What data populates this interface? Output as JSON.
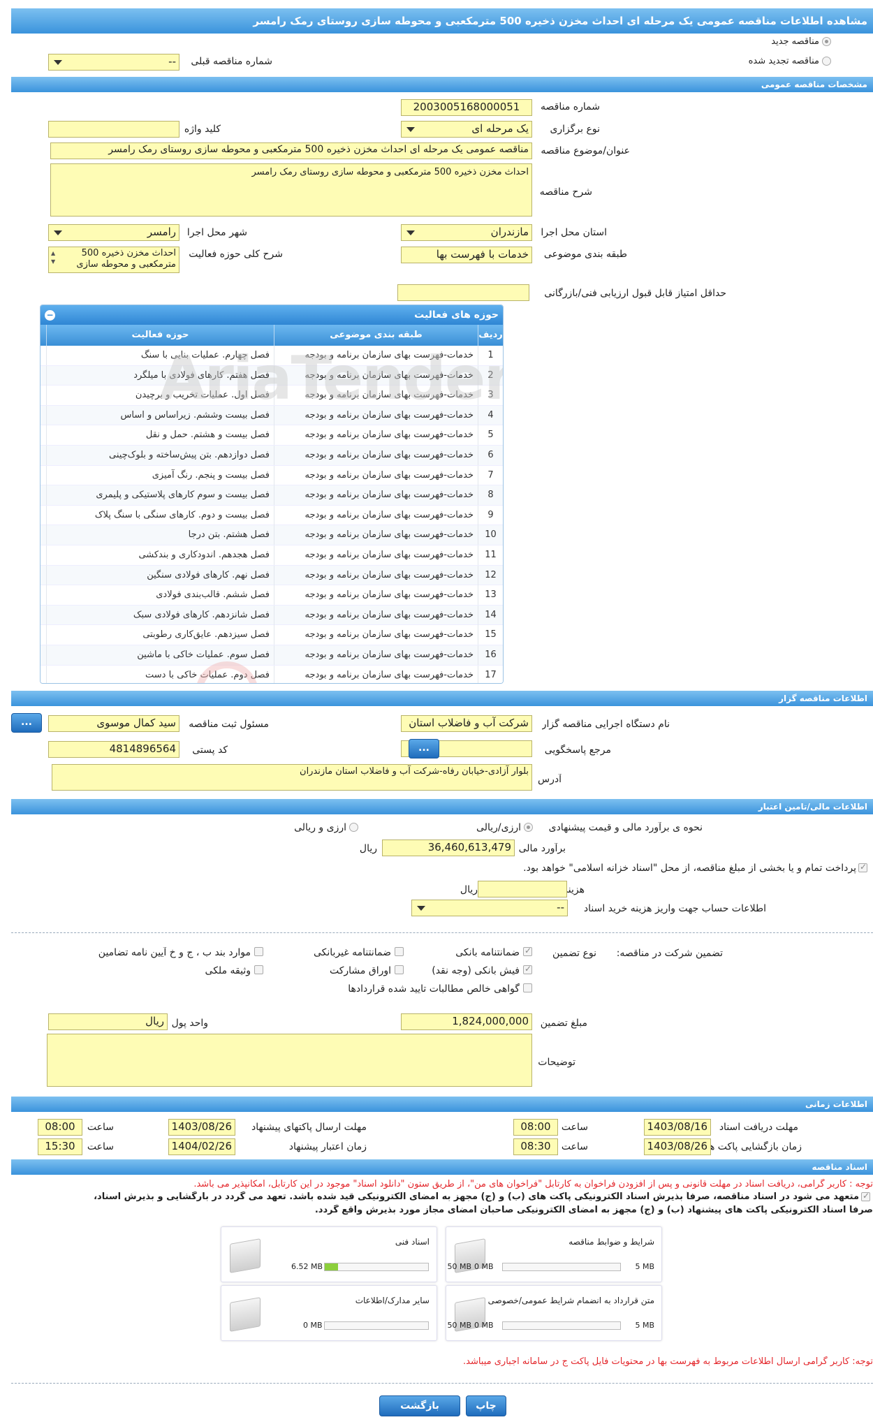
{
  "title": "مشاهده اطلاعات مناقصه عمومی یک مرحله ای احداث مخزن ذخیره 500 مترمکعبی و محوطه سازی روستای رمک رامسر",
  "top": {
    "new_label": "مناقصه جدید",
    "renewed_label": "مناقصه تجدید شده",
    "prev_number_label": "شماره مناقصه قبلی",
    "prev_number_value": "--"
  },
  "general": {
    "section": "مشخصات مناقصه عمومی",
    "number_label": "شماره مناقصه",
    "number": "2003005168000051",
    "type_label": "نوع برگزاری",
    "type": "یک مرحله ای",
    "keyword_label": "کلید واژه",
    "keyword": "",
    "subject_label": "عنوان/موضوع مناقصه",
    "subject": "مناقصه عمومی یک مرحله ای احداث مخزن ذخیره  500 مترمکعبی و محوطه سازی روستای رمک رامسر",
    "desc_label": "شرح مناقصه",
    "desc": "احداث مخزن ذخیره  500 مترمکعبی و محوطه سازی روستای رمک رامسر",
    "province_label": "استان محل اجرا",
    "province": "مازندران",
    "city_label": "شهر محل اجرا",
    "city": "رامسر",
    "category_label": "طبقه بندی موضوعی",
    "category": "خدمات با فهرست بها",
    "activity_label": "شرح کلی حوزه فعالیت",
    "activity": "احداث مخزن ذخیره  500 مترمکعبی و محوطه سازی",
    "min_score_label": "حداقل امتیاز قابل قبول ارزیابی فنی/بازرگانی",
    "min_score": ""
  },
  "grid": {
    "title": "حوزه های فعالیت",
    "col_row": "ردیف",
    "col_cat": "طبقه بندی موضوعی",
    "col_field": "حوزه فعالیت",
    "rows": [
      [
        "1",
        "خدمات-فهرست بهای سازمان برنامه و بودجه",
        "فصل چهارم. عملیات بنایی با سنگ"
      ],
      [
        "2",
        "خدمات-فهرست بهای سازمان برنامه و بودجه",
        "فصل هفتم. کارهای فولادی با میلگرد"
      ],
      [
        "3",
        "خدمات-فهرست بهای سازمان برنامه و بودجه",
        "فصل اول. عملیات تخریب و برچیدن"
      ],
      [
        "4",
        "خدمات-فهرست بهای سازمان برنامه و بودجه",
        "فصل بیست وششم. زیراساس و اساس"
      ],
      [
        "5",
        "خدمات-فهرست بهای سازمان برنامه و بودجه",
        "فصل بیست و هشتم. حمل و نقل"
      ],
      [
        "6",
        "خدمات-فهرست بهای سازمان برنامه و بودجه",
        "فصل دوازدهم. بتن پیش‌ساخته و بلوک‌چینی"
      ],
      [
        "7",
        "خدمات-فهرست بهای سازمان برنامه و بودجه",
        "فصل بیست و پنجم. رنگ آمیزی"
      ],
      [
        "8",
        "خدمات-فهرست بهای سازمان برنامه و بودجه",
        "فصل بیست و سوم کارهای پلاستیکی و پلیمری"
      ],
      [
        "9",
        "خدمات-فهرست بهای سازمان برنامه و بودجه",
        "فصل بیست و دوم. کارهای سنگی با سنگ پلاک"
      ],
      [
        "10",
        "خدمات-فهرست بهای سازمان برنامه و بودجه",
        "فصل هشتم. بتن درجا"
      ],
      [
        "11",
        "خدمات-فهرست بهای سازمان برنامه و بودجه",
        "فصل هجدهم. اندودکاری و بندکشی"
      ],
      [
        "12",
        "خدمات-فهرست بهای سازمان برنامه و بودجه",
        "فصل نهم. کارهای فولادی سنگین"
      ],
      [
        "13",
        "خدمات-فهرست بهای سازمان برنامه و بودجه",
        "فصل ششم. قالب‌بندی فولادی"
      ],
      [
        "14",
        "خدمات-فهرست بهای سازمان برنامه و بودجه",
        "فصل شانزدهم. کارهای فولادی سبک"
      ],
      [
        "15",
        "خدمات-فهرست بهای سازمان برنامه و بودجه",
        "فصل سیزدهم. عایق‌کاری رطوبتی"
      ],
      [
        "16",
        "خدمات-فهرست بهای سازمان برنامه و بودجه",
        "فصل سوم. عملیات خاکی با ماشین"
      ],
      [
        "17",
        "خدمات-فهرست بهای سازمان برنامه و بودجه",
        "فصل دوم. عملیات خاکی با دست"
      ]
    ]
  },
  "org": {
    "section": "اطلاعات مناقصه گزار",
    "name_label": "نام دستگاه اجرایی مناقصه گزار",
    "name": "شرکت آب و فاضلاب استان",
    "resp_label": "مسئول ثبت مناقصه",
    "resp": "سید کمال موسوی",
    "ref_label": "مرجع پاسخگویی",
    "ref": "",
    "postal_label": "کد پستی",
    "postal": "4814896564",
    "address_label": "آدرس",
    "address": "بلوار آزادی-خیابان رفاه-شرکت آب و فاضلاب استان مازندران",
    "more": "..."
  },
  "finance": {
    "section": "اطلاعات مالی/تامین اعتبار",
    "est_type_label": "نحوه ی برآورد مالی و قیمت پیشنهادی",
    "opt1": "ارزی/ریالی",
    "opt2": "ارزی و ریالی",
    "estimate_label": "برآورد مالی",
    "estimate": "36,460,613,479",
    "rial": "ریال",
    "treasury": "پرداخت تمام و یا بخشی از مبلغ مناقصه، از محل \"اسناد خزانه اسلامی\" خواهد بود.",
    "doc_fee_label": "هزینه خرید اسناد",
    "doc_fee": "",
    "account_label": "اطلاعات حساب جهت واریز هزینه خرید اسناد",
    "account": "--"
  },
  "guarantee": {
    "label": "تضمین شرکت در مناقصه:",
    "type_label": "نوع تضمین",
    "bank": "ضمانتنامه بانکی",
    "nonbank": "ضمانتنامه غیربانکی",
    "items_bcd": "موارد بند ب ، ج و خ آیین نامه تضامین",
    "cash": "فیش بانکی (وجه نقد)",
    "bonds": "اوراق مشارکت",
    "property": "وثیقه ملکی",
    "claims": "گواهی خالص مطالبات تایید شده قراردادها",
    "amount_label": "مبلغ تضمین",
    "amount": "1,824,000,000",
    "currency_label": "واحد پول",
    "currency": "ریال",
    "notes_label": "توضیحات",
    "notes": ""
  },
  "timing": {
    "section": "اطلاعات زمانی",
    "recv_label": "مهلت دریافت اسناد",
    "recv_date": "1403/08/16",
    "recv_time": "08:00",
    "send_label": "مهلت ارسال پاکتهای پیشنهاد",
    "send_date": "1403/08/26",
    "send_time": "08:00",
    "open_label": "زمان بازگشایی پاکت ها",
    "open_date": "1403/08/26",
    "open_time": "08:30",
    "valid_label": "زمان اعتبار پیشنهاد",
    "valid_date": "1404/02/26",
    "valid_time": "15:30",
    "time_label": "ساعت"
  },
  "docs": {
    "section": "اسناد مناقصه",
    "note1": "توجه : کاربر گرامی، دریافت اسناد در مهلت قانونی و پس از افزودن فراخوان به کارتابل \"فراخوان های من\"، از طریق ستون \"دانلود اسناد\" موجود در این کارتابل، امکانپذیر می باشد.",
    "commit1": "متعهد می شود در اسناد مناقصه، صرفاً بذیرش اسناد الکترونیکی پاکت های (ب) و (ج) مجهز به امضای الکترونیکی قید شده باشد. تعهد می گردد در بارگشایی و بذیرش اسناد،",
    "commit2": "صرفاً اسناد الکترونیکی پاکت های پیشنهاد (ب) و (ج) مجهز به امضای الکترونیکی صاحبان امضای مجاز مورد بذیرش واقع گردد.",
    "cards": [
      {
        "title": "شرایط و ضوابط مناقصه",
        "min": "0 MB",
        "max": "5 MB",
        "fill": 0
      },
      {
        "title": "اسناد فنی",
        "min": "6.52 MB",
        "max": "50 MB",
        "fill": 0.13
      },
      {
        "title": "متن قرارداد به انضمام شرایط عمومی/خصوصی",
        "min": "0 MB",
        "max": "5 MB",
        "fill": 0
      },
      {
        "title": "سایر مدارک/اطلاعات",
        "min": "0 MB",
        "max": "50 MB",
        "fill": 0
      }
    ],
    "note2": "توجه: کاربر گرامی ارسال اطلاعات مربوط به فهرست بها در محتویات فایل پاکت ج در سامانه اجباری میباشد."
  },
  "buttons": {
    "print": "چاپ",
    "back": "بازگشت"
  }
}
